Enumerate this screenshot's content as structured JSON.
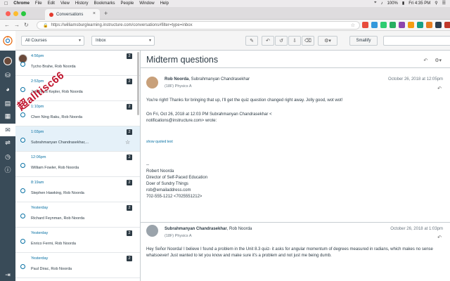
{
  "menubar": {
    "items": [
      "Chrome",
      "File",
      "Edit",
      "View",
      "History",
      "Bookmarks",
      "People",
      "Window",
      "Help"
    ],
    "battery": "100%",
    "clock": "Fri 4:35 PM"
  },
  "browser": {
    "tab_title": "Conversations",
    "url": "https://williamsburglearning.instructure.com/conversations#filter=type=inbox",
    "extension_colors": [
      "#e74c3c",
      "#3498db",
      "#2ecc71",
      "#27ae60",
      "#8e44ad",
      "#f39c12",
      "#16a085",
      "#e67e22",
      "#2c3e50",
      "#c0392b",
      "#7f8c8d",
      "#d35400"
    ]
  },
  "toolbar": {
    "course_filter": "All Courses",
    "mailbox_filter": "Inbox",
    "smallify_label": "Smallify",
    "search_placeholder": ""
  },
  "conversations": [
    {
      "date": "4:56pm",
      "people": "Tycho Brahe, Rob Noorda",
      "count": "2",
      "avatar": true
    },
    {
      "date": "2:53pm",
      "people": "Johannes Kepler, Rob Noorda",
      "count": "2"
    },
    {
      "date": "1:10pm",
      "people": "Chen Ning Raku, Rob Noorda",
      "count": "2"
    },
    {
      "date": "1:03pm",
      "people": "Subrahmanyan Chandrasekhar,...",
      "count": "2",
      "selected": true
    },
    {
      "date": "12:06pm",
      "people": "William Fowler, Rob Noorda",
      "count": "2"
    },
    {
      "date": "8:19am",
      "people": "Stephen Hawking, Rob Noorda",
      "count": "2"
    },
    {
      "date": "Yesterday",
      "people": "Richard Feynman, Rob Noorda",
      "count": "2"
    },
    {
      "date": "Yesterday",
      "people": "Enrico Fermi, Rob Noorda",
      "count": "2"
    },
    {
      "date": "Yesterday",
      "people": "Paul Dirac, Rob Noorda",
      "count": "2"
    }
  ],
  "watermark": "超alltisc66",
  "detail": {
    "subject": "Midterm questions",
    "messages": [
      {
        "sender_name": "Rob Noorda",
        "sender_rest": ", Subrahmanyan Chandrasekhar",
        "course": "(18F) Physics A",
        "date": "October 26, 2018 at 12:05pm",
        "body1": "You're right! Thanks for bringing that up, I'll get the quiz question changed right away. Jolly good, wot wot!",
        "body2": "On Fri, Oct 26, 2018 at 12:03 PM Subrahmanyan Chandrasekhar <",
        "body3": "notifications@instructure.com> wrote:",
        "show_quoted": "show quoted text",
        "sig": [
          "--",
          "Robert Noorda",
          "Director of Self-Paced Education",
          "Doer of Sundry Things",
          "rob@emailaddress.com",
          "702-555-1212 <7025551212>"
        ]
      },
      {
        "sender_name": "Subrahmanyan Chandrasekhar",
        "sender_rest": ", Rob Noorda",
        "course": "(18F) Physics A",
        "date": "October 26, 2018 at 1:03pm",
        "body1": "Hey Señor Noorda! I believe I found a problem in the Unit 8.3 quiz- it asks for angular momentum of degrees measured in radians, which makes no sense whatsoever! Just wanted to let you know and make sure it's a problem and not just me being dumb."
      }
    ]
  }
}
